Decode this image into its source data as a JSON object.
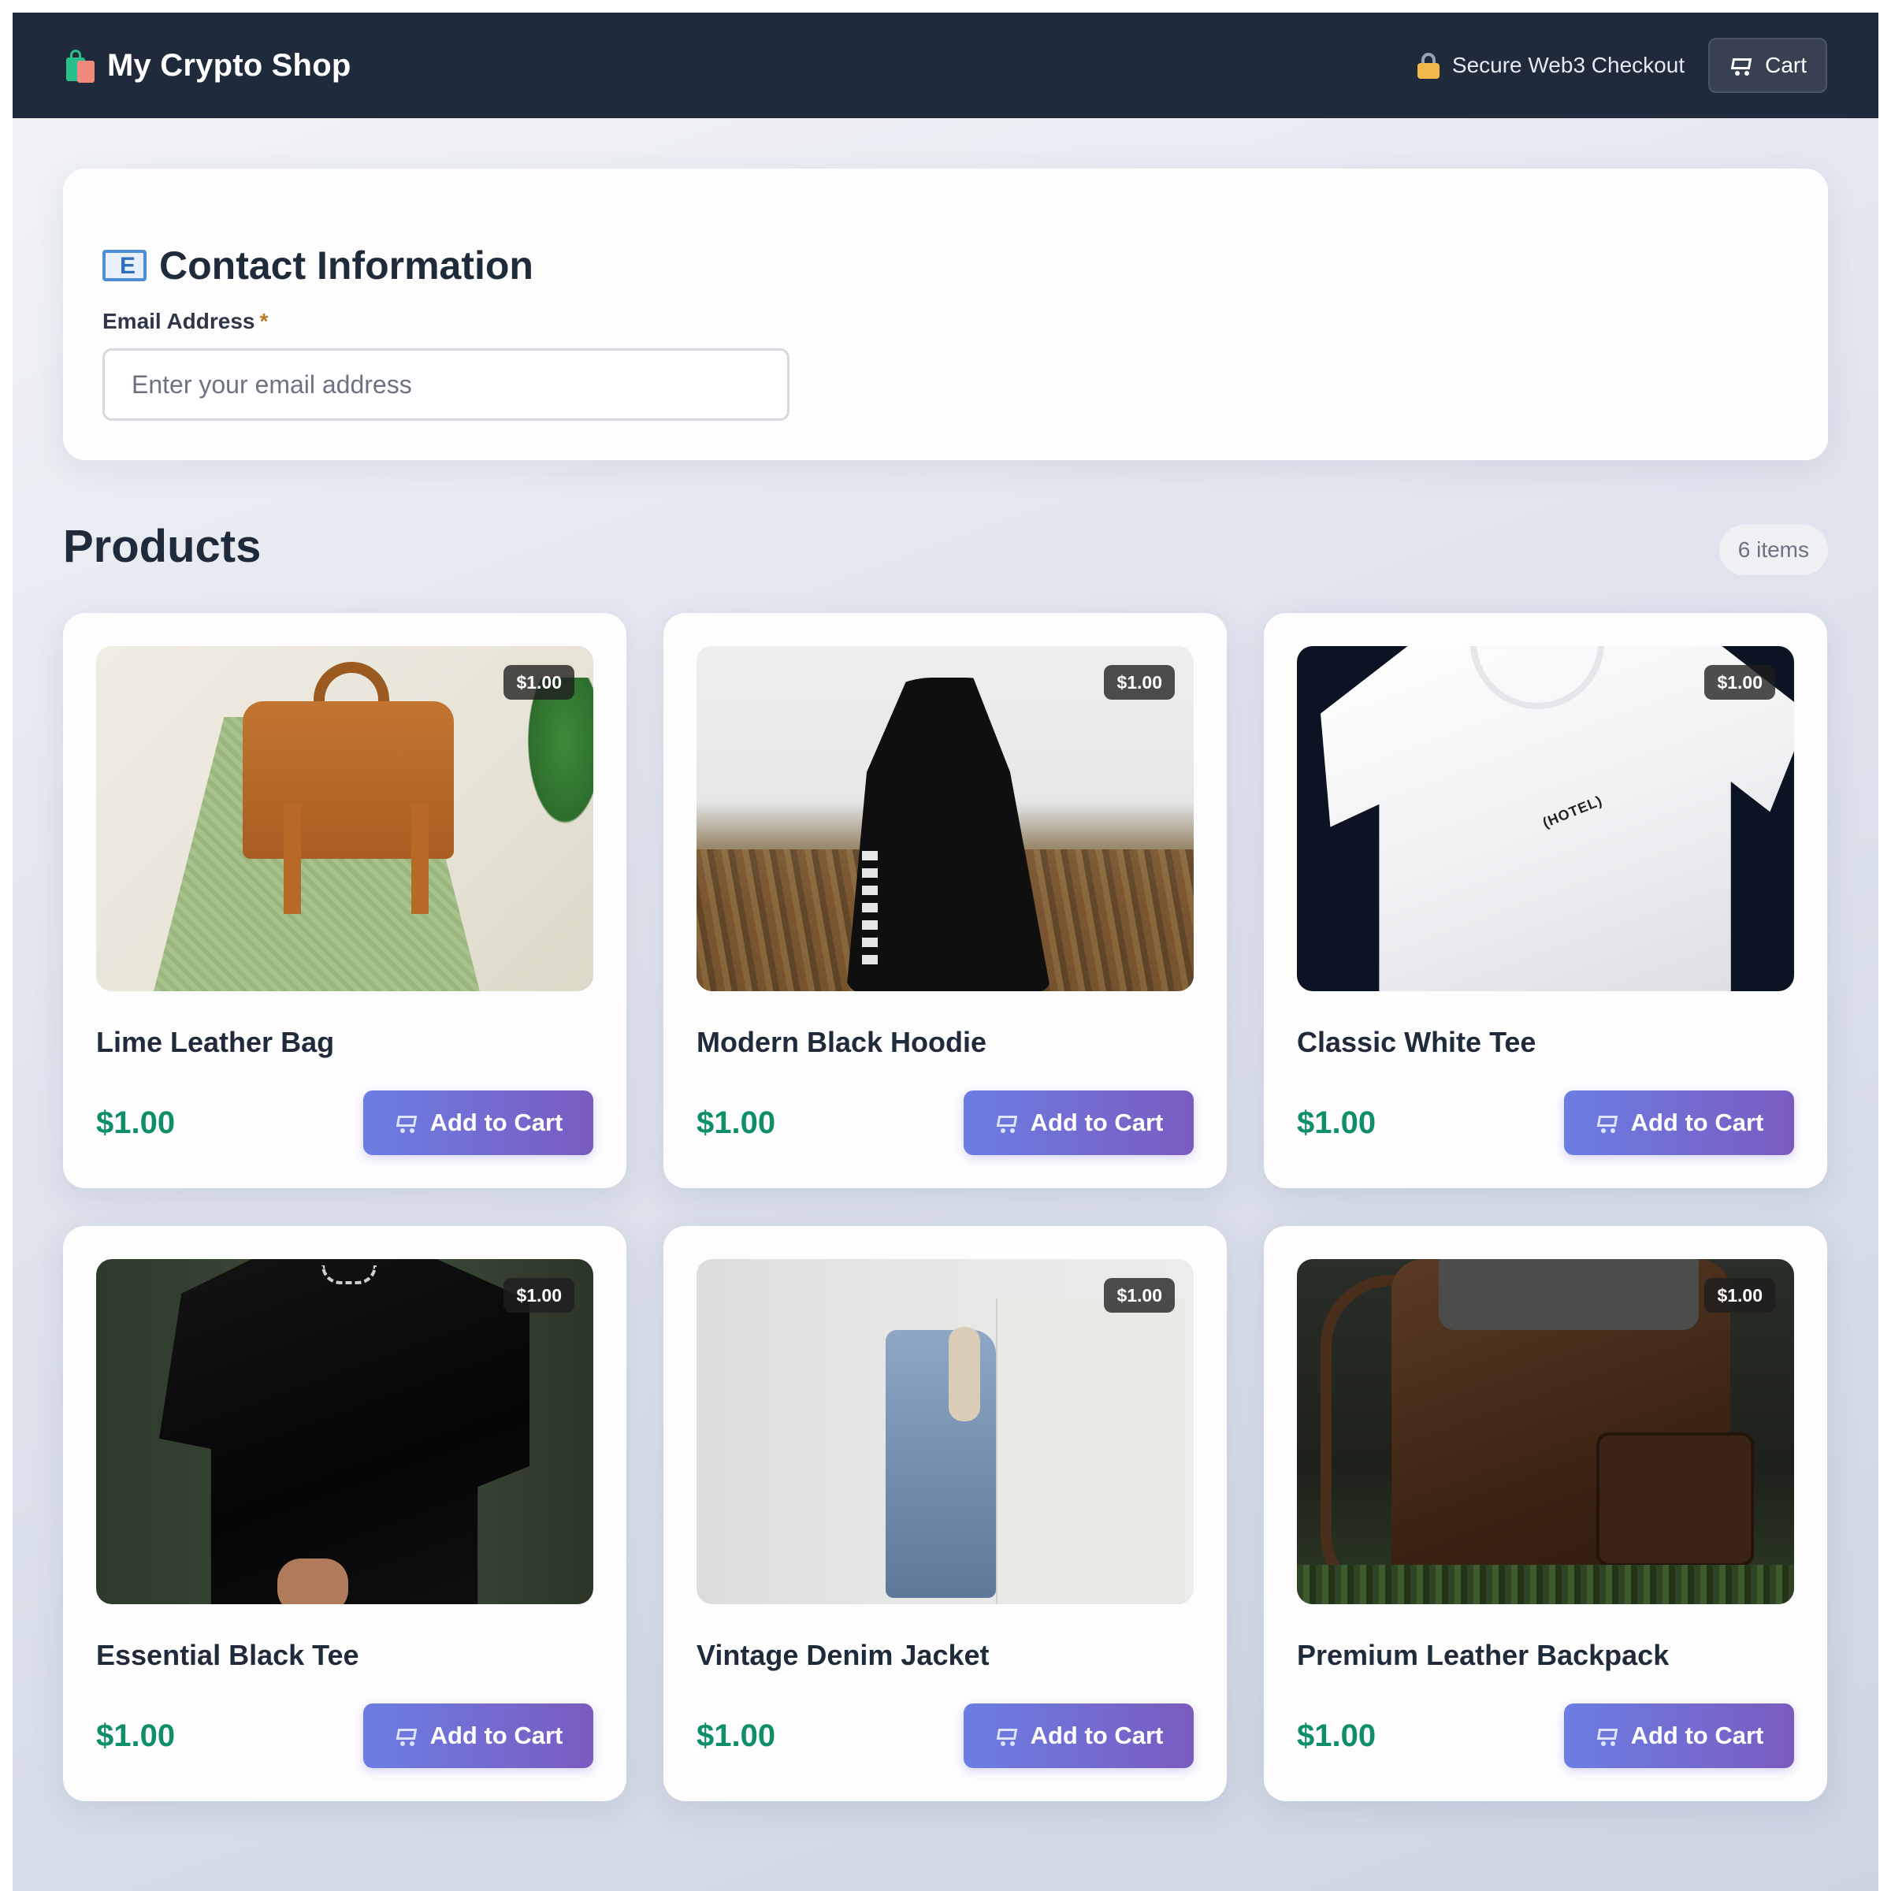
{
  "header": {
    "brand_icon": "shopping-bags-icon",
    "title": "My Crypto Shop",
    "secure_icon": "lock-with-key-icon",
    "secure_text": "Secure Web3 Checkout",
    "cart_icon": "cart-icon",
    "cart_label": "Cart"
  },
  "contact": {
    "icon": "envelope-icon",
    "title": "Contact Information",
    "email_label": "Email Address",
    "required_mark": "*",
    "email_value": "",
    "email_placeholder": "Enter your email address"
  },
  "products": {
    "title": "Products",
    "count_label": "6 items",
    "add_label": "Add to Cart",
    "items": [
      {
        "name": "Lime Leather Bag",
        "price": "$1.00",
        "badge": "$1.00"
      },
      {
        "name": "Modern Black Hoodie",
        "price": "$1.00",
        "badge": "$1.00"
      },
      {
        "name": "Classic White Tee",
        "price": "$1.00",
        "badge": "$1.00"
      },
      {
        "name": "Essential Black Tee",
        "price": "$1.00",
        "badge": "$1.00"
      },
      {
        "name": "Vintage Denim Jacket",
        "price": "$1.00",
        "badge": "$1.00"
      },
      {
        "name": "Premium Leather Backpack",
        "price": "$1.00",
        "badge": "$1.00"
      }
    ]
  },
  "colors": {
    "header_bg": "#1f2a3b",
    "price_green": "#0e8f6a",
    "button_gradient_start": "#6b7ee3",
    "button_gradient_end": "#7a5bc0"
  }
}
